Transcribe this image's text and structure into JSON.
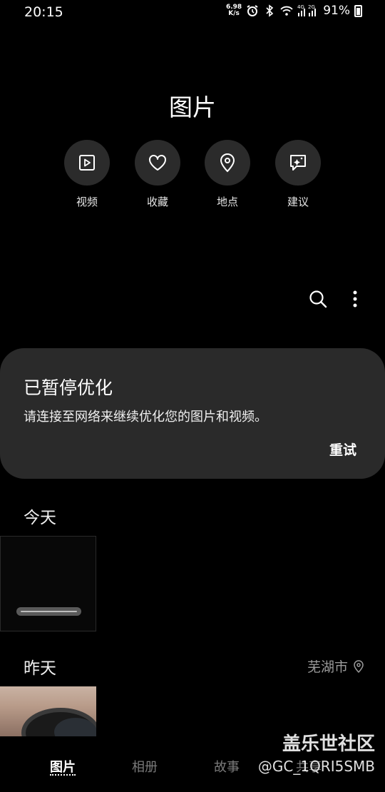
{
  "status_bar": {
    "time": "20:15",
    "net_speed_value": "6.98",
    "net_speed_unit": "K/s",
    "signal_label_1": "4G",
    "signal_label_2": "2G",
    "battery": "91%",
    "icons": [
      "alarm-icon",
      "bluetooth-icon",
      "wifi-icon",
      "signal-icon",
      "battery-icon"
    ]
  },
  "header": {
    "title": "图片"
  },
  "quick_actions": [
    {
      "label": "视频",
      "icon": "video-icon"
    },
    {
      "label": "收藏",
      "icon": "heart-icon"
    },
    {
      "label": "地点",
      "icon": "location-pin-icon"
    },
    {
      "label": "建议",
      "icon": "suggestion-icon"
    }
  ],
  "toolbar": {
    "search_icon": "search-icon",
    "more_icon": "more-vertical-icon"
  },
  "notice": {
    "title": "已暂停优化",
    "body": "请连接至网络来继续优化您的图片和视频。",
    "retry_label": "重试"
  },
  "sections": [
    {
      "title": "今天"
    },
    {
      "title": "昨天",
      "location": "芜湖市"
    }
  ],
  "bottom_nav": {
    "items": [
      {
        "label": "图片",
        "active": true
      },
      {
        "label": "相册",
        "active": false
      },
      {
        "label": "故事",
        "active": false
      },
      {
        "label": "共享",
        "active": false
      }
    ]
  },
  "watermark": {
    "site": "盖乐世社区",
    "user": "@GC_1QRI5SMB"
  }
}
